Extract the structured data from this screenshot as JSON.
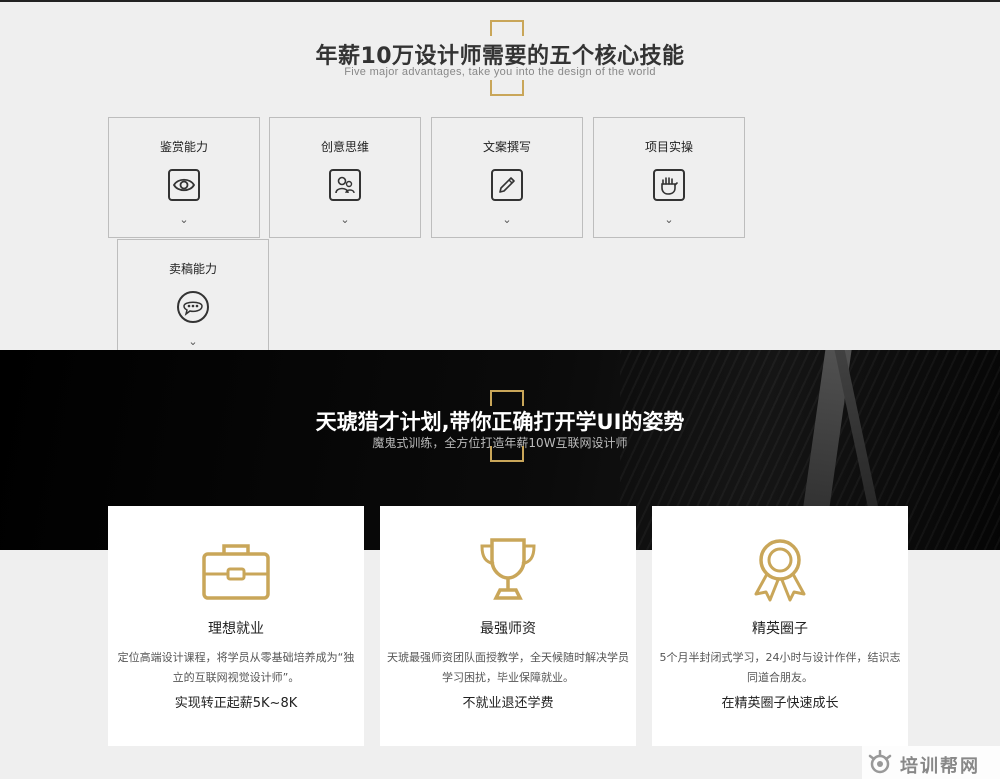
{
  "section1": {
    "title": "年薪10万设计师需要的五个核心技能",
    "subtitle": "Five major advantages, take you into the design of the world",
    "skills": [
      {
        "label": "鉴赏能力",
        "icon": "eye-icon"
      },
      {
        "label": "创意思维",
        "icon": "people-icon"
      },
      {
        "label": "文案撰写",
        "icon": "pencil-icon"
      },
      {
        "label": "项目实操",
        "icon": "hand-icon"
      },
      {
        "label": "卖稿能力",
        "icon": "chat-bubble-icon"
      }
    ],
    "chevron": "⌄"
  },
  "section2": {
    "title": "天琥猎才计划,带你正确打开学UI的姿势",
    "subtitle": "魔鬼式训练，全方位打造年薪10W互联网设计师"
  },
  "features": [
    {
      "icon": "briefcase-icon",
      "title": "理想就业",
      "desc": "定位高端设计课程，将学员从零基础培养成为“独立的互联网视觉设计师”。",
      "note": "实现转正起薪5K~8K"
    },
    {
      "icon": "trophy-icon",
      "title": "最强师资",
      "desc": "天琥最强师资团队面授教学，全天候随时解决学员学习困扰，毕业保障就业。",
      "note": "不就业退还学费"
    },
    {
      "icon": "medal-icon",
      "title": "精英圈子",
      "desc": "5个月半封闭式学习，24小时与设计作伴，结识志同道合朋友。",
      "note": "在精英圈子快速成长"
    }
  ],
  "colors": {
    "gold": "#c9a659",
    "dark": "#000000",
    "bg": "#efefef"
  },
  "watermark": {
    "text": "培训帮网"
  }
}
